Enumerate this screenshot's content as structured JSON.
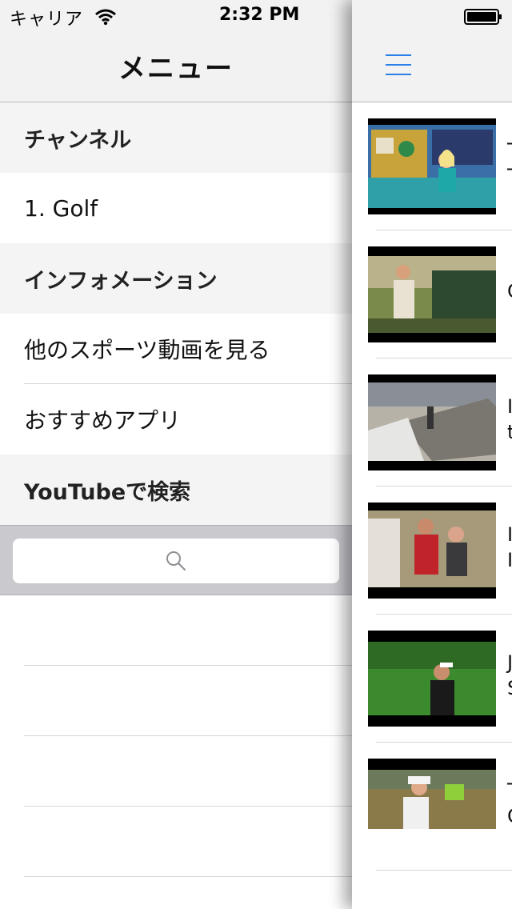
{
  "status_bar": {
    "carrier": "キャリア",
    "time": "2:32 PM"
  },
  "menu": {
    "title": "メニュー",
    "rows": [
      {
        "type": "section",
        "label": "チャンネル"
      },
      {
        "type": "item",
        "label": "1. Golf"
      },
      {
        "type": "section",
        "label": "インフォメーション"
      },
      {
        "type": "item",
        "label": "他のスポーツ動画を見る"
      },
      {
        "type": "item",
        "label": "おすすめアプリ"
      },
      {
        "type": "section",
        "label": "YouTubeで検索"
      }
    ],
    "search": {
      "placeholder": ""
    }
  },
  "content": {
    "menu_button_icon": "hamburger-menu-icon",
    "accent_color": "#2a7fe8",
    "videos": [
      {
        "title_line1": "T",
        "title_line2": "T"
      },
      {
        "title_line1": "C",
        "title_line2": ""
      },
      {
        "title_line1": "I",
        "title_line2": "t"
      },
      {
        "title_line1": "I",
        "title_line2": "I"
      },
      {
        "title_line1": "J",
        "title_line2": "S"
      },
      {
        "title_line1": "T",
        "title_line2": "C"
      }
    ]
  }
}
